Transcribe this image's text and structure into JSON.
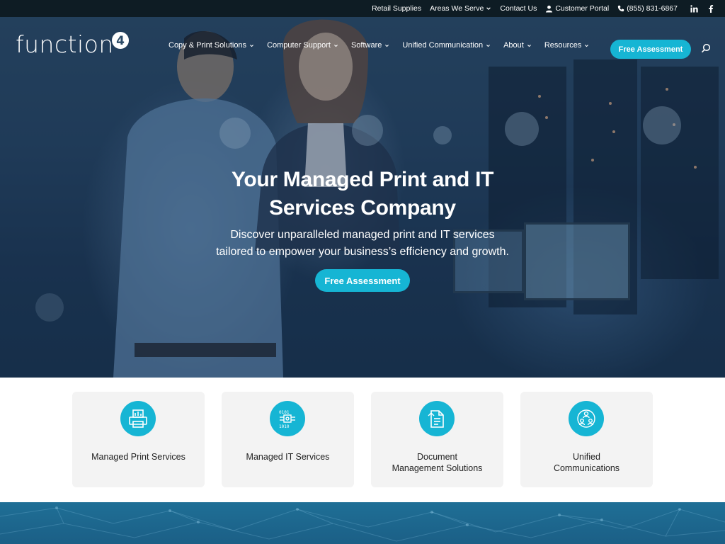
{
  "topbar": {
    "retail_supplies": "Retail Supplies",
    "areas_we_serve": "Areas We Serve",
    "contact_us": "Contact Us",
    "customer_portal": "Customer Portal",
    "phone": "(855) 831-6867",
    "social": {
      "linkedin_icon": "linkedin-icon",
      "facebook_icon": "facebook-icon"
    }
  },
  "header": {
    "logo_text": "function",
    "logo_badge": "4",
    "nav": [
      {
        "label": "Copy & Print Solutions"
      },
      {
        "label": "Computer Support"
      },
      {
        "label": "Software"
      },
      {
        "label": "Unified Communication"
      },
      {
        "label": "About"
      },
      {
        "label": "Resources"
      }
    ],
    "cta_label": "Free Assessment"
  },
  "hero": {
    "title_line1": "Your Managed Print and IT",
    "title_line2": "Services Company",
    "subtitle_line1": "Discover unparalleled managed print and IT services",
    "subtitle_line2": "tailored to empower your business’s efficiency and growth.",
    "cta_label": "Free Assessment"
  },
  "services": [
    {
      "label": "Managed Print Services",
      "icon": "printer-icon"
    },
    {
      "label": "Managed IT Services",
      "icon": "circuit-chip-icon"
    },
    {
      "label": "Document\nManagement Solutions",
      "icon": "document-icon"
    },
    {
      "label": "Unified\nCommunications",
      "icon": "people-network-icon"
    }
  ],
  "colors": {
    "accent": "#16b5d4",
    "topbar": "#0e1c24",
    "band": "#1f6f96"
  }
}
